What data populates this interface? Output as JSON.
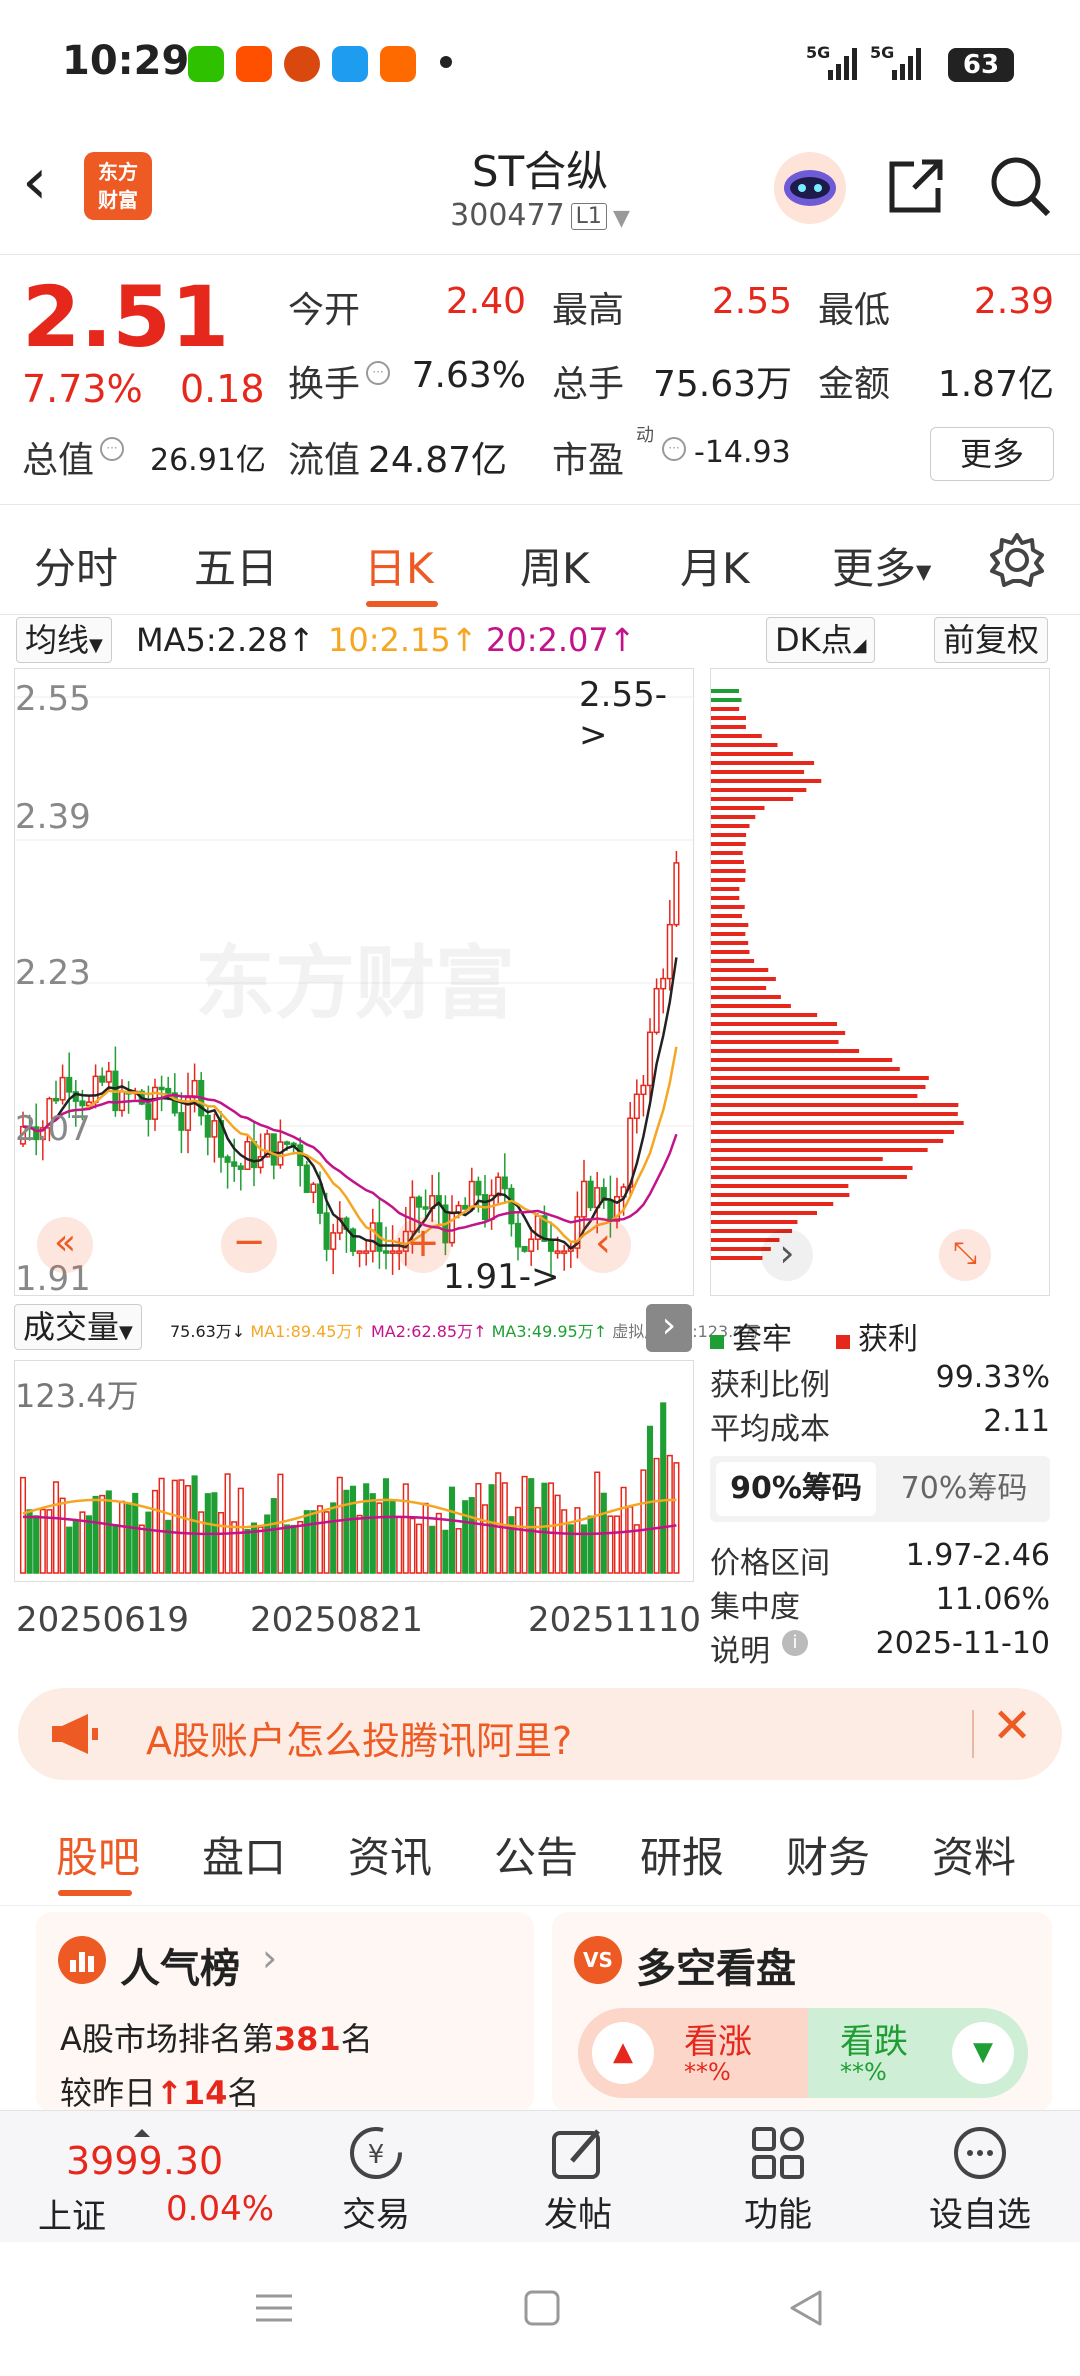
{
  "status_bar": {
    "time": "10:29",
    "battery": "63",
    "net1": "5G",
    "net2": "5G"
  },
  "header": {
    "title": "ST合纵",
    "code": "300477",
    "market_tag": "L1",
    "logo_text": "东方财富"
  },
  "quote": {
    "price": "2.51",
    "change_pct": "7.73%",
    "change": "0.18",
    "open_label": "今开",
    "open": "2.40",
    "high_label": "最高",
    "high": "2.55",
    "low_label": "最低",
    "low": "2.39",
    "turnover_label": "换手",
    "turnover": "7.63%",
    "volume_label": "总手",
    "volume": "75.63万",
    "amount_label": "金额",
    "amount": "1.87亿",
    "mcap_label": "总值",
    "mcap": "26.91亿",
    "float_label": "流值",
    "float": "24.87亿",
    "pe_label": "市盈",
    "pe_sup": "动",
    "pe": "-14.93",
    "more": "更多"
  },
  "period_tabs": [
    "分时",
    "五日",
    "日K",
    "周K",
    "月K",
    "更多"
  ],
  "active_period": "日K",
  "ma_row": {
    "selector": "均线",
    "ma5": "MA5:2.28↑",
    "ma10": "10:2.15↑",
    "ma20": "20:2.07↑",
    "dk": "DK点",
    "fq": "前复权"
  },
  "kline": {
    "y_labels": [
      "2.55",
      "2.39",
      "2.23",
      "2.07",
      "1.91"
    ],
    "high_marker": "2.55->",
    "low_marker": "1.91->",
    "watermark": "东方财富"
  },
  "volume_panel": {
    "selector": "成交量",
    "legend": "75.63万↓",
    "ma1": "MA1:89.45万↑",
    "ma2": "MA2:62.85万↑",
    "ma3": "MA3:49.95万↑",
    "virtual": "虚拟成交量:123.4万",
    "max_label": "123.4万",
    "dates": [
      "20250619",
      "20250821",
      "20251110"
    ]
  },
  "chips": {
    "legend_trap": "套牢",
    "legend_profit": "获利",
    "profit_ratio_label": "获利比例",
    "profit_ratio": "99.33%",
    "avg_cost_label": "平均成本",
    "avg_cost": "2.11",
    "tab90": "90%筹码",
    "tab70": "70%筹码",
    "range_label": "价格区间",
    "range": "1.97-2.46",
    "conc_label": "集中度",
    "conc": "11.06%",
    "note_label": "说明",
    "note_date": "2025-11-10"
  },
  "ad_banner": {
    "text": "A股账户怎么投腾讯阿里?"
  },
  "bottom_tabs": [
    "股吧",
    "盘口",
    "资讯",
    "公告",
    "研报",
    "财务",
    "资料"
  ],
  "active_bottom_tab": "股吧",
  "cards": {
    "popularity_title": "人气榜",
    "rank_prefix": "A股市场排名第",
    "rank": "381",
    "rank_suffix": "名",
    "rank_change_prefix": "较昨日",
    "rank_change": "14",
    "rank_change_suffix": "名",
    "bullbear_title": "多空看盘",
    "bull_label": "看涨",
    "bull_value": "**%",
    "bear_label": "看跌",
    "bear_value": "**%"
  },
  "bottom_bar": {
    "index_value": "3999.30",
    "index_name": "上证",
    "index_change": "0.04%",
    "trade": "交易",
    "post": "发帖",
    "func": "功能",
    "watch": "设自选"
  },
  "colors": {
    "up": "#e5271c",
    "down": "#1f9e34",
    "accent": "#ee5a24",
    "ma10": "#f5a623",
    "ma20": "#c2138a"
  }
}
